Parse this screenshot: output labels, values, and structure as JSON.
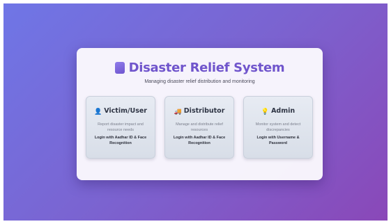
{
  "app": {
    "title": "Disaster Relief System",
    "subtitle": "Managing disaster relief distribution and monitoring",
    "logo_icon": "purple-square-icon",
    "accent_color": "#7055cc"
  },
  "roles": [
    {
      "icon": "👤",
      "icon_name": "person-icon",
      "label": "Victim/User",
      "description": "Report disaster impact and resource needs",
      "login": "Login with Aadhar ID & Face Recognition"
    },
    {
      "icon": "🚚",
      "icon_name": "truck-icon",
      "label": "Distributor",
      "description": "Manage and distribute relief resources",
      "login": "Login with Aadhar ID & Face Recognition"
    },
    {
      "icon": "💡",
      "icon_name": "lightbulb-icon",
      "label": "Admin",
      "description": "Monitor system and detect discrepancies",
      "login": "Login with Username & Password"
    }
  ]
}
